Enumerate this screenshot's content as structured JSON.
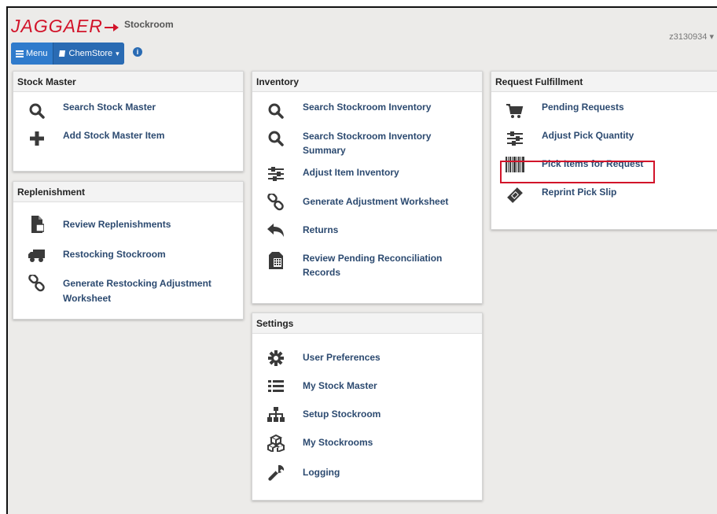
{
  "header": {
    "logo_text": "JAGGAER",
    "app_title": "Stockroom",
    "user": "z3130934",
    "menu_label": "Menu",
    "store_label": "ChemStore",
    "info_icon": "info-icon",
    "colors": {
      "brand": "#d2142a",
      "menu_blue": "#2a6bb3",
      "link": "#2c4a70",
      "background": "#ecebe9"
    }
  },
  "panels": {
    "stock_master": {
      "title": "Stock Master",
      "items": [
        {
          "label": "Search Stock Master",
          "icon": "search-icon"
        },
        {
          "label": "Add Stock Master Item",
          "icon": "plus-icon"
        }
      ]
    },
    "replenishment": {
      "title": "Replenishment",
      "items": [
        {
          "label": "Review Replenishments",
          "icon": "document-icon"
        },
        {
          "label": "Restocking Stockroom",
          "icon": "truck-icon"
        },
        {
          "label": "Generate Restocking Adjustment",
          "label2": "Worksheet",
          "icon": "link-icon"
        }
      ]
    },
    "inventory": {
      "title": "Inventory",
      "items": [
        {
          "label": "Search Stockroom Inventory",
          "icon": "search-icon"
        },
        {
          "label": "Search Stockroom Inventory",
          "label2": "Summary",
          "icon": "search-icon"
        },
        {
          "label": "Adjust Item Inventory",
          "icon": "sliders-icon"
        },
        {
          "label": "Generate Adjustment Worksheet",
          "icon": "link-icon"
        },
        {
          "label": "Returns",
          "icon": "reply-icon"
        },
        {
          "label": "Review Pending Reconciliation",
          "label2": "Records",
          "icon": "calculator-icon"
        }
      ]
    },
    "settings": {
      "title": "Settings",
      "items": [
        {
          "label": "User Preferences",
          "icon": "gear-icon"
        },
        {
          "label": "My Stock Master",
          "icon": "list-icon"
        },
        {
          "label": "Setup Stockroom",
          "icon": "sitemap-icon"
        },
        {
          "label": "My Stockrooms",
          "icon": "cubes-icon"
        },
        {
          "label": "Logging",
          "icon": "wrench-icon"
        }
      ]
    },
    "request_fulfillment": {
      "title": "Request Fulfillment",
      "items": [
        {
          "label": "Pending Requests",
          "icon": "cart-icon"
        },
        {
          "label": "Adjust Pick Quantity",
          "icon": "sliders-icon"
        },
        {
          "label": "Pick Items for Request",
          "icon": "barcode-icon"
        },
        {
          "label": "Reprint Pick Slip",
          "icon": "ticket-icon"
        }
      ]
    }
  }
}
